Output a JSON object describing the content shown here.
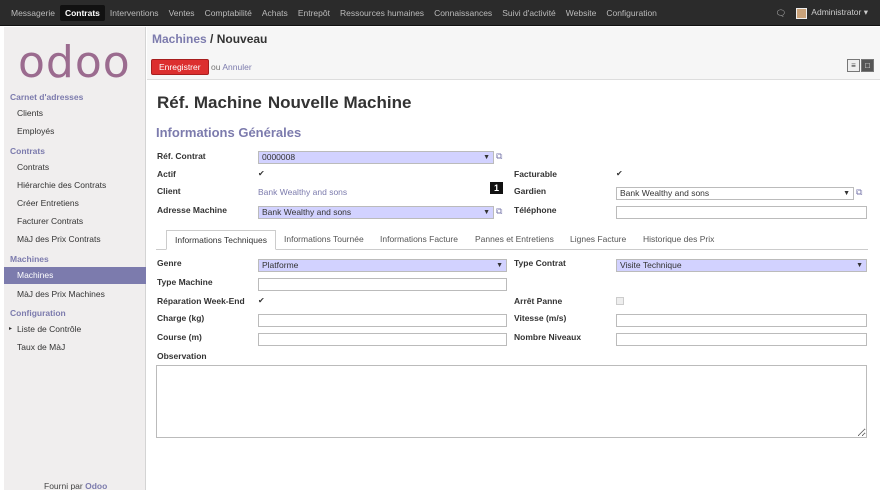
{
  "topbar": {
    "menu": [
      "Messagerie",
      "Contrats",
      "Interventions",
      "Ventes",
      "Comptabilité",
      "Achats",
      "Entrepôt",
      "Ressources humaines",
      "Connaissances",
      "Suivi d'activité",
      "Website",
      "Configuration"
    ],
    "active_index": 1,
    "user": "Administrator ▾",
    "chat_icon": "chat-icon"
  },
  "sidebar": {
    "logo": "odoo",
    "sections": [
      {
        "title": "Carnet d'adresses",
        "items": [
          "Clients",
          "Employés"
        ]
      },
      {
        "title": "Contrats",
        "items": [
          "Contrats",
          "Hiérarchie des Contrats",
          "Créer Entretiens",
          "Facturer Contrats",
          "MàJ des Prix Contrats"
        ]
      },
      {
        "title": "Machines",
        "items": [
          "Machines",
          "MàJ des Prix Machines"
        ]
      },
      {
        "title": "Configuration",
        "items": [
          "Liste de Contrôle",
          "Taux de MàJ"
        ]
      }
    ],
    "active_item": "Machines",
    "footer_prefix": "Fourni par",
    "footer_brand": "Odoo"
  },
  "header": {
    "breadcrumb_link": "Machines",
    "breadcrumb_sep": " / ",
    "breadcrumb_current": "Nouveau",
    "save_label": "Enregistrer",
    "or_label": "ou",
    "cancel_label": "Annuler"
  },
  "form": {
    "title_label": "Réf. Machine",
    "title_value": "Nouvelle Machine",
    "section": "Informations Générales",
    "ref_contrat_label": "Réf. Contrat",
    "ref_contrat_value": "0000008",
    "actif_label": "Actif",
    "facturable_label": "Facturable",
    "client_label": "Client",
    "client_value": "Bank Wealthy and sons",
    "badge": "1",
    "gardien_label": "Gardien",
    "gardien_value": "Bank Wealthy and sons",
    "adresse_label": "Adresse Machine",
    "adresse_value": "Bank Wealthy and sons",
    "telephone_label": "Téléphone",
    "tabs": [
      "Informations Techniques",
      "Informations Tournée",
      "Informations Facture",
      "Pannes et Entretiens",
      "Lignes Facture",
      "Historique des Prix"
    ],
    "genre_label": "Genre",
    "genre_value": "Platforme",
    "type_contrat_label": "Type Contrat",
    "type_contrat_value": "Visite Technique",
    "type_machine_label": "Type Machine",
    "reparation_label": "Réparation Week-End",
    "arret_label": "Arrêt Panne",
    "charge_label": "Charge (kg)",
    "vitesse_label": "Vitesse (m/s)",
    "course_label": "Course (m)",
    "niveaux_label": "Nombre Niveaux",
    "observation_label": "Observation"
  }
}
